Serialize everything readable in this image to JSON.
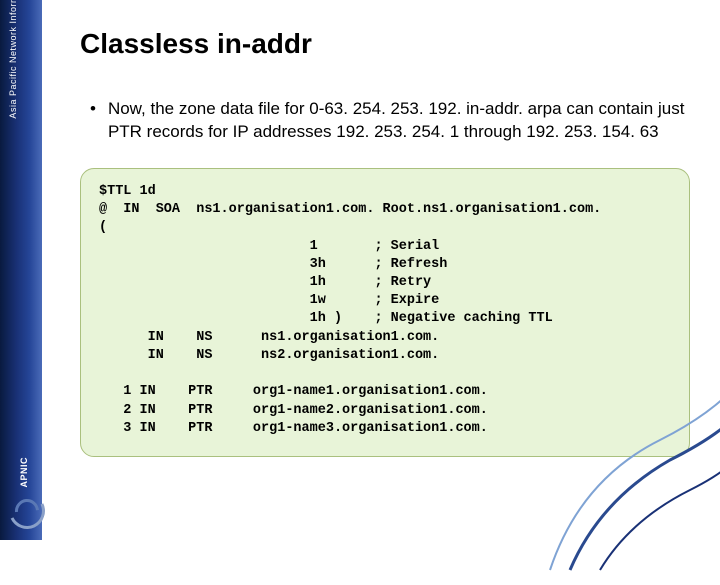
{
  "sidebar": {
    "org_name": "Asia Pacific Network Information Centre",
    "logo_text": "APNIC"
  },
  "title": "Classless in-addr",
  "bullet": "Now, the zone data file for 0-63. 254. 253. 192. in-addr. arpa can contain just PTR records for IP addresses 192. 253. 254. 1 through 192. 253. 154. 63",
  "code": "$TTL 1d\n@  IN  SOA  ns1.organisation1.com. Root.ns1.organisation1.com.\n(\n                          1       ; Serial\n                          3h      ; Refresh\n                          1h      ; Retry\n                          1w      ; Expire\n                          1h )    ; Negative caching TTL\n      IN    NS      ns1.organisation1.com.\n      IN    NS      ns2.organisation1.com.\n\n   1 IN    PTR     org1-name1.organisation1.com.\n   2 IN    PTR     org1-name2.organisation1.com.\n   3 IN    PTR     org1-name3.organisation1.com."
}
